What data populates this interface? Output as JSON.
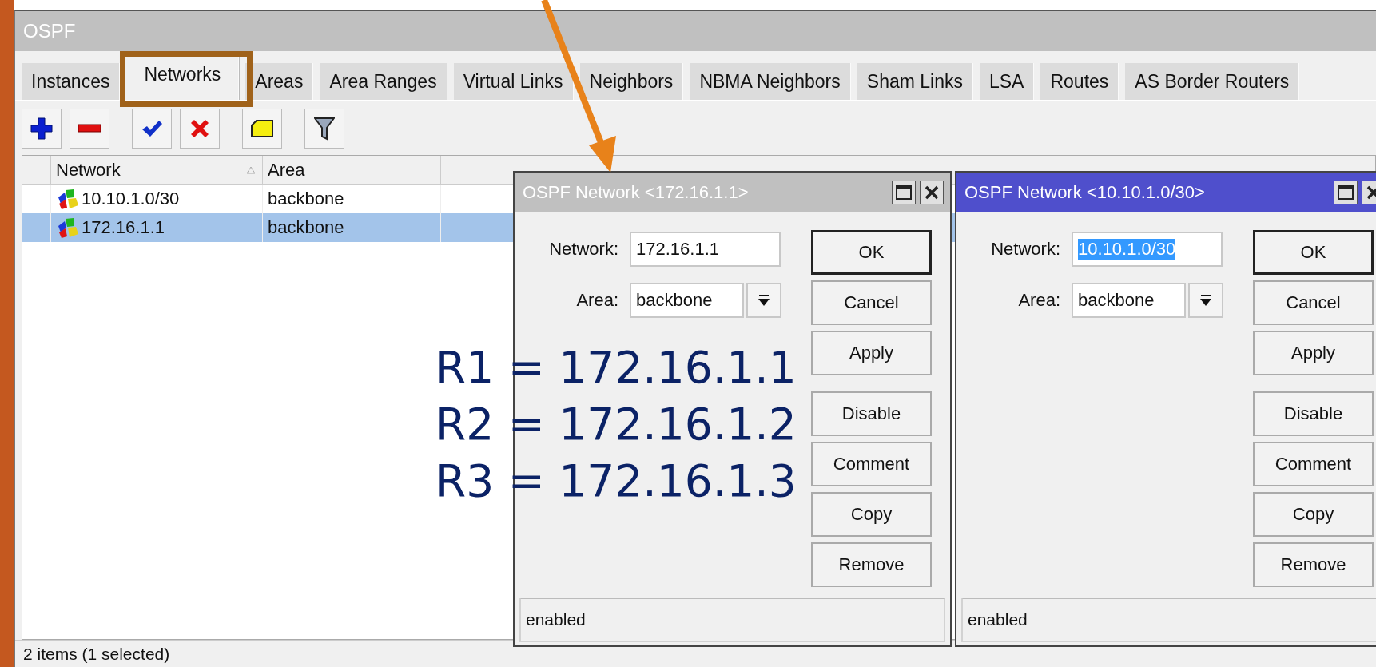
{
  "window": {
    "title": "OSPF"
  },
  "tabs": [
    {
      "label": "Instances",
      "selected": false
    },
    {
      "label": "Networks",
      "selected": true
    },
    {
      "label": "Areas",
      "selected": false
    },
    {
      "label": "Area Ranges",
      "selected": false
    },
    {
      "label": "Virtual Links",
      "selected": false
    },
    {
      "label": "Neighbors",
      "selected": false
    },
    {
      "label": "NBMA Neighbors",
      "selected": false
    },
    {
      "label": "Sham Links",
      "selected": false
    },
    {
      "label": "LSA",
      "selected": false
    },
    {
      "label": "Routes",
      "selected": false
    },
    {
      "label": "AS Border Routers",
      "selected": false
    }
  ],
  "table": {
    "columns": [
      "Network",
      "Area"
    ],
    "rows": [
      {
        "network": "10.10.1.0/30",
        "area": "backbone",
        "selected": false
      },
      {
        "network": "172.16.1.1",
        "area": "backbone",
        "selected": true
      }
    ]
  },
  "status_bar": "2 items (1 selected)",
  "dialogs": [
    {
      "title": "OSPF Network <172.16.1.1>",
      "active": false,
      "fields": [
        {
          "kind": "text",
          "label": "Network:",
          "value": "172.16.1.1",
          "text_selected": false
        },
        {
          "kind": "dropdown",
          "label": "Area:",
          "value": "backbone"
        }
      ],
      "button_groups": [
        [
          {
            "label": "OK",
            "default": true
          },
          {
            "label": "Cancel",
            "default": false
          },
          {
            "label": "Apply",
            "default": false
          }
        ],
        [
          {
            "label": "Disable",
            "default": false
          },
          {
            "label": "Comment",
            "default": false
          },
          {
            "label": "Copy",
            "default": false
          },
          {
            "label": "Remove",
            "default": false
          }
        ]
      ],
      "status": "enabled"
    },
    {
      "title": "OSPF Network <10.10.1.0/30>",
      "active": true,
      "fields": [
        {
          "kind": "text",
          "label": "Network:",
          "value": "10.10.1.0/30",
          "text_selected": true
        },
        {
          "kind": "dropdown",
          "label": "Area:",
          "value": "backbone"
        }
      ],
      "button_groups": [
        [
          {
            "label": "OK",
            "default": true
          },
          {
            "label": "Cancel",
            "default": false
          },
          {
            "label": "Apply",
            "default": false
          }
        ],
        [
          {
            "label": "Disable",
            "default": false
          },
          {
            "label": "Comment",
            "default": false
          },
          {
            "label": "Copy",
            "default": false
          },
          {
            "label": "Remove",
            "default": false
          }
        ]
      ],
      "status": "enabled"
    }
  ],
  "annotation": {
    "lines": [
      "R1 = 172.16.1.1",
      "R2 = 172.16.1.2",
      "R3 = 172.16.1.3"
    ]
  }
}
